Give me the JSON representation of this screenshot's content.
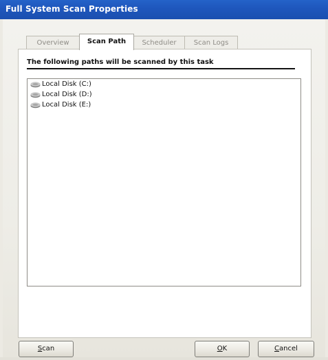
{
  "window": {
    "title": "Full System Scan Properties"
  },
  "tabs": [
    {
      "label": "Overview",
      "active": false
    },
    {
      "label": "Scan Path",
      "active": true
    },
    {
      "label": "Scheduler",
      "active": false
    },
    {
      "label": "Scan Logs",
      "active": false
    }
  ],
  "panel": {
    "header": "The following paths will be scanned by this task",
    "paths": [
      {
        "label": "Local Disk (C:)",
        "icon": "drive-icon"
      },
      {
        "label": "Local Disk (D:)",
        "icon": "drive-icon"
      },
      {
        "label": "Local Disk (E:)",
        "icon": "drive-icon"
      }
    ]
  },
  "buttons": {
    "scan": {
      "prefix": "",
      "accel": "S",
      "rest": "can"
    },
    "ok": {
      "prefix": "",
      "accel": "O",
      "rest": "K"
    },
    "cancel": {
      "prefix": "",
      "accel": "C",
      "rest": "ancel"
    }
  },
  "colors": {
    "titlebar": "#1f57bd",
    "window_bg": "#eceae3",
    "panel_bg": "#ffffff"
  }
}
